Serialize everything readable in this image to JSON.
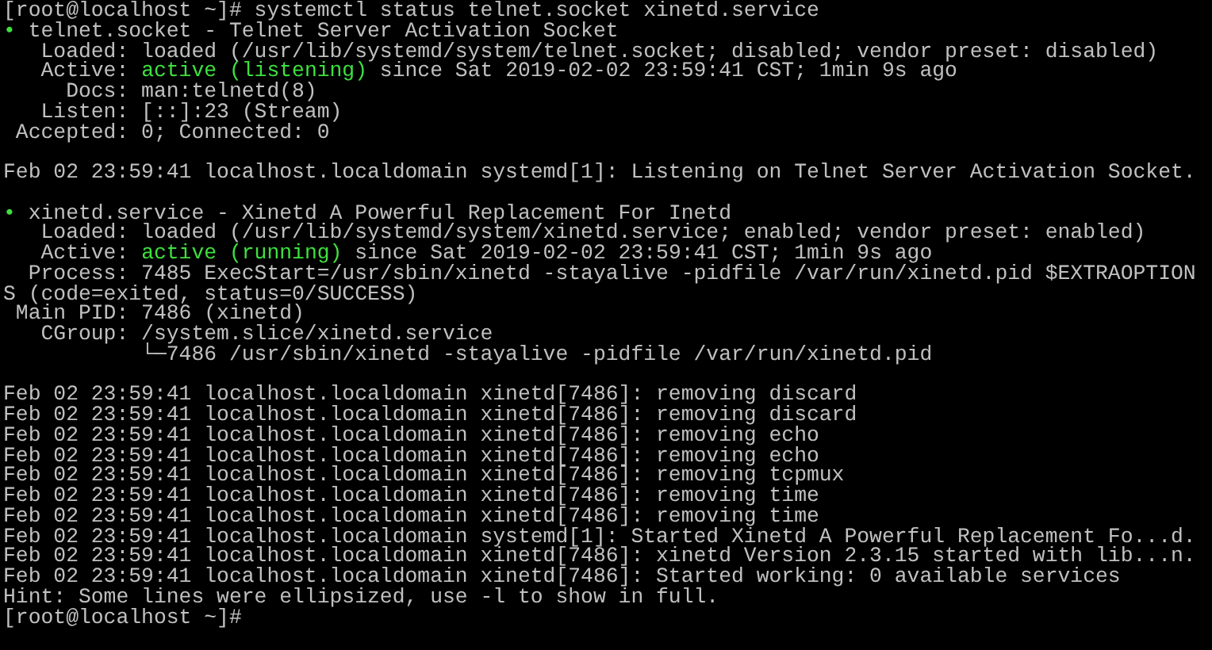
{
  "terminal": {
    "lines": [
      {
        "kind": "text",
        "segments": [
          {
            "kind": "plain",
            "text": "[root@localhost ~]# systemctl status telnet.socket xinetd.service"
          }
        ]
      },
      {
        "kind": "text",
        "segments": [
          {
            "kind": "bullet",
            "text": "•"
          },
          {
            "kind": "plain",
            "text": " telnet.socket - Telnet Server Activation Socket"
          }
        ]
      },
      {
        "kind": "text",
        "segments": [
          {
            "kind": "plain",
            "text": "   Loaded: loaded (/usr/lib/systemd/system/telnet.socket; disabled; vendor preset: disabled)"
          }
        ]
      },
      {
        "kind": "text",
        "segments": [
          {
            "kind": "plain",
            "text": "   Active: "
          },
          {
            "kind": "status",
            "text": "active (listening)"
          },
          {
            "kind": "plain",
            "text": " since Sat 2019-02-02 23:59:41 CST; 1min 9s ago"
          }
        ]
      },
      {
        "kind": "text",
        "segments": [
          {
            "kind": "plain",
            "text": "     Docs: man:telnetd(8)"
          }
        ]
      },
      {
        "kind": "text",
        "segments": [
          {
            "kind": "plain",
            "text": "   Listen: [::]:23 (Stream)"
          }
        ]
      },
      {
        "kind": "text",
        "segments": [
          {
            "kind": "plain",
            "text": " Accepted: 0; Connected: 0"
          }
        ]
      },
      {
        "kind": "blank"
      },
      {
        "kind": "text",
        "segments": [
          {
            "kind": "plain",
            "text": "Feb 02 23:59:41 localhost.localdomain systemd[1]: Listening on Telnet Server Activation Socket."
          }
        ]
      },
      {
        "kind": "blank"
      },
      {
        "kind": "text",
        "segments": [
          {
            "kind": "bullet",
            "text": "•"
          },
          {
            "kind": "plain",
            "text": " xinetd.service - Xinetd A Powerful Replacement For Inetd"
          }
        ]
      },
      {
        "kind": "text",
        "segments": [
          {
            "kind": "plain",
            "text": "   Loaded: loaded (/usr/lib/systemd/system/xinetd.service; enabled; vendor preset: enabled)"
          }
        ]
      },
      {
        "kind": "text",
        "segments": [
          {
            "kind": "plain",
            "text": "   Active: "
          },
          {
            "kind": "status",
            "text": "active (running)"
          },
          {
            "kind": "plain",
            "text": " since Sat 2019-02-02 23:59:41 CST; 1min 9s ago"
          }
        ]
      },
      {
        "kind": "text",
        "segments": [
          {
            "kind": "plain",
            "text": "  Process: 7485 ExecStart=/usr/sbin/xinetd -stayalive -pidfile /var/run/xinetd.pid $EXTRAOPTION"
          }
        ]
      },
      {
        "kind": "text",
        "segments": [
          {
            "kind": "plain",
            "text": "S (code=exited, status=0/SUCCESS)"
          }
        ]
      },
      {
        "kind": "text",
        "segments": [
          {
            "kind": "plain",
            "text": " Main PID: 7486 (xinetd)"
          }
        ]
      },
      {
        "kind": "text",
        "segments": [
          {
            "kind": "plain",
            "text": "   CGroup: /system.slice/xinetd.service"
          }
        ]
      },
      {
        "kind": "text",
        "segments": [
          {
            "kind": "plain",
            "text": "           └─7486 /usr/sbin/xinetd -stayalive -pidfile /var/run/xinetd.pid"
          }
        ]
      },
      {
        "kind": "blank"
      },
      {
        "kind": "text",
        "segments": [
          {
            "kind": "plain",
            "text": "Feb 02 23:59:41 localhost.localdomain xinetd[7486]: removing discard"
          }
        ]
      },
      {
        "kind": "text",
        "segments": [
          {
            "kind": "plain",
            "text": "Feb 02 23:59:41 localhost.localdomain xinetd[7486]: removing discard"
          }
        ]
      },
      {
        "kind": "text",
        "segments": [
          {
            "kind": "plain",
            "text": "Feb 02 23:59:41 localhost.localdomain xinetd[7486]: removing echo"
          }
        ]
      },
      {
        "kind": "text",
        "segments": [
          {
            "kind": "plain",
            "text": "Feb 02 23:59:41 localhost.localdomain xinetd[7486]: removing echo"
          }
        ]
      },
      {
        "kind": "text",
        "segments": [
          {
            "kind": "plain",
            "text": "Feb 02 23:59:41 localhost.localdomain xinetd[7486]: removing tcpmux"
          }
        ]
      },
      {
        "kind": "text",
        "segments": [
          {
            "kind": "plain",
            "text": "Feb 02 23:59:41 localhost.localdomain xinetd[7486]: removing time"
          }
        ]
      },
      {
        "kind": "text",
        "segments": [
          {
            "kind": "plain",
            "text": "Feb 02 23:59:41 localhost.localdomain xinetd[7486]: removing time"
          }
        ]
      },
      {
        "kind": "text",
        "segments": [
          {
            "kind": "plain",
            "text": "Feb 02 23:59:41 localhost.localdomain systemd[1]: Started Xinetd A Powerful Replacement Fo...d."
          }
        ]
      },
      {
        "kind": "text",
        "segments": [
          {
            "kind": "plain",
            "text": "Feb 02 23:59:41 localhost.localdomain xinetd[7486]: xinetd Version 2.3.15 started with lib...n."
          }
        ]
      },
      {
        "kind": "text",
        "segments": [
          {
            "kind": "plain",
            "text": "Feb 02 23:59:41 localhost.localdomain xinetd[7486]: Started working: 0 available services"
          }
        ]
      },
      {
        "kind": "text",
        "segments": [
          {
            "kind": "plain",
            "text": "Hint: Some lines were ellipsized, use -l to show in full."
          }
        ]
      },
      {
        "kind": "text",
        "segments": [
          {
            "kind": "plain",
            "text": "[root@localhost ~]#"
          }
        ]
      }
    ]
  }
}
